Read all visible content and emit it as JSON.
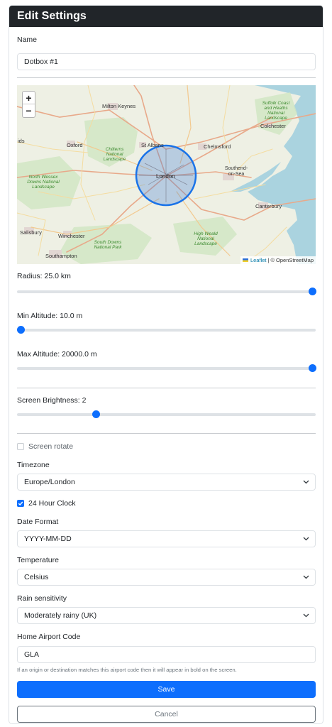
{
  "header": {
    "title": "Edit Settings"
  },
  "name": {
    "label": "Name",
    "value": "Dotbox #1"
  },
  "map": {
    "zoom_in": "+",
    "zoom_out": "−",
    "places": [
      "Milton Keynes",
      "Oxford",
      "St Albans",
      "Colchester",
      "Chelmsford",
      "London",
      "Southend-on-Sea",
      "Canterbury",
      "Salisbury",
      "Winchester",
      "Southampton",
      "ids"
    ],
    "landscapes": [
      "Chilterns National Landscape",
      "North Wessex Downs National Landscape",
      "South Downs National Park",
      "High Weald National Landscape",
      "Suffolk Coast and Heaths National Landscape"
    ],
    "attribution_leaflet": "Leaflet",
    "attribution_sep": " | © ",
    "attribution_osm": "OpenStreetMap",
    "accent": "#1a73e8"
  },
  "radius": {
    "label": "Radius: 25.0 km",
    "fraction": 1.0
  },
  "min_altitude": {
    "label": "Min Altitude: 10.0 m",
    "fraction": 0.0
  },
  "max_altitude": {
    "label": "Max Altitude: 20000.0 m",
    "fraction": 1.0
  },
  "brightness": {
    "label": "Screen Brightness: 2",
    "fraction": 0.257
  },
  "screen_rotate": {
    "label": "Screen rotate",
    "checked": false
  },
  "timezone": {
    "label": "Timezone",
    "value": "Europe/London"
  },
  "clock24": {
    "label": "24 Hour Clock",
    "checked": true
  },
  "date_format": {
    "label": "Date Format",
    "value": "YYYY-MM-DD"
  },
  "temperature": {
    "label": "Temperature",
    "value": "Celsius"
  },
  "rain": {
    "label": "Rain sensitivity",
    "value": "Moderately rainy (UK)"
  },
  "airport": {
    "label": "Home Airport Code",
    "value": "GLA",
    "help": "If an origin or destination matches this airport code then it will appear in bold on the screen."
  },
  "buttons": {
    "save": "Save",
    "cancel": "Cancel"
  },
  "colors": {
    "primary": "#0d6efd",
    "header_bg": "#212529"
  }
}
